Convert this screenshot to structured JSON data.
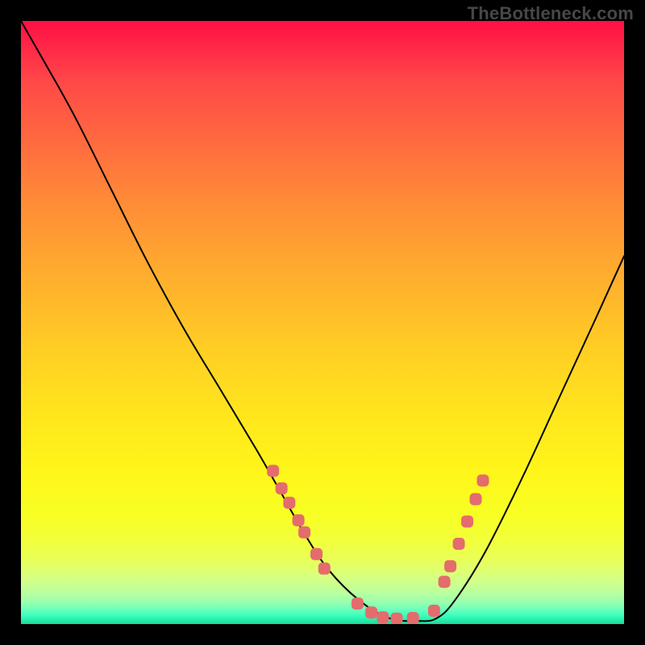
{
  "watermark": "TheBottleneck.com",
  "chart_data": {
    "type": "line",
    "title": "",
    "xlabel": "",
    "ylabel": "",
    "xlim": [
      0,
      1
    ],
    "ylim": [
      0,
      1
    ],
    "legend": false,
    "grid": false,
    "background": "rainbow-vertical",
    "note": "Axes are unlabeled in the source image; x and y are normalized to [0,1] with y=1 at the top of the plot area and y=0 at the bottom.",
    "series": [
      {
        "name": "bottleneck-curve",
        "x": [
          0.0,
          0.04,
          0.09,
          0.15,
          0.21,
          0.27,
          0.33,
          0.39,
          0.43,
          0.47,
          0.51,
          0.56,
          0.61,
          0.66,
          0.69,
          0.72,
          0.77,
          0.83,
          0.89,
          0.95,
          1.0
        ],
        "y": [
          1.0,
          0.93,
          0.84,
          0.72,
          0.6,
          0.49,
          0.39,
          0.29,
          0.22,
          0.15,
          0.09,
          0.04,
          0.01,
          0.005,
          0.01,
          0.04,
          0.12,
          0.24,
          0.37,
          0.5,
          0.61
        ]
      }
    ],
    "markers": {
      "name": "highlighted-points",
      "note": "Salmon rounded-square markers clustered along the lower portion of the curve near the minimum.",
      "points": [
        {
          "x": 0.418,
          "y": 0.254
        },
        {
          "x": 0.432,
          "y": 0.225
        },
        {
          "x": 0.445,
          "y": 0.201
        },
        {
          "x": 0.46,
          "y": 0.172
        },
        {
          "x": 0.47,
          "y": 0.152
        },
        {
          "x": 0.49,
          "y": 0.116
        },
        {
          "x": 0.503,
          "y": 0.092
        },
        {
          "x": 0.558,
          "y": 0.034
        },
        {
          "x": 0.581,
          "y": 0.019
        },
        {
          "x": 0.6,
          "y": 0.011
        },
        {
          "x": 0.623,
          "y": 0.009
        },
        {
          "x": 0.65,
          "y": 0.01
        },
        {
          "x": 0.685,
          "y": 0.022
        },
        {
          "x": 0.702,
          "y": 0.07
        },
        {
          "x": 0.712,
          "y": 0.096
        },
        {
          "x": 0.726,
          "y": 0.133
        },
        {
          "x": 0.74,
          "y": 0.17
        },
        {
          "x": 0.754,
          "y": 0.207
        },
        {
          "x": 0.766,
          "y": 0.238
        }
      ]
    }
  }
}
